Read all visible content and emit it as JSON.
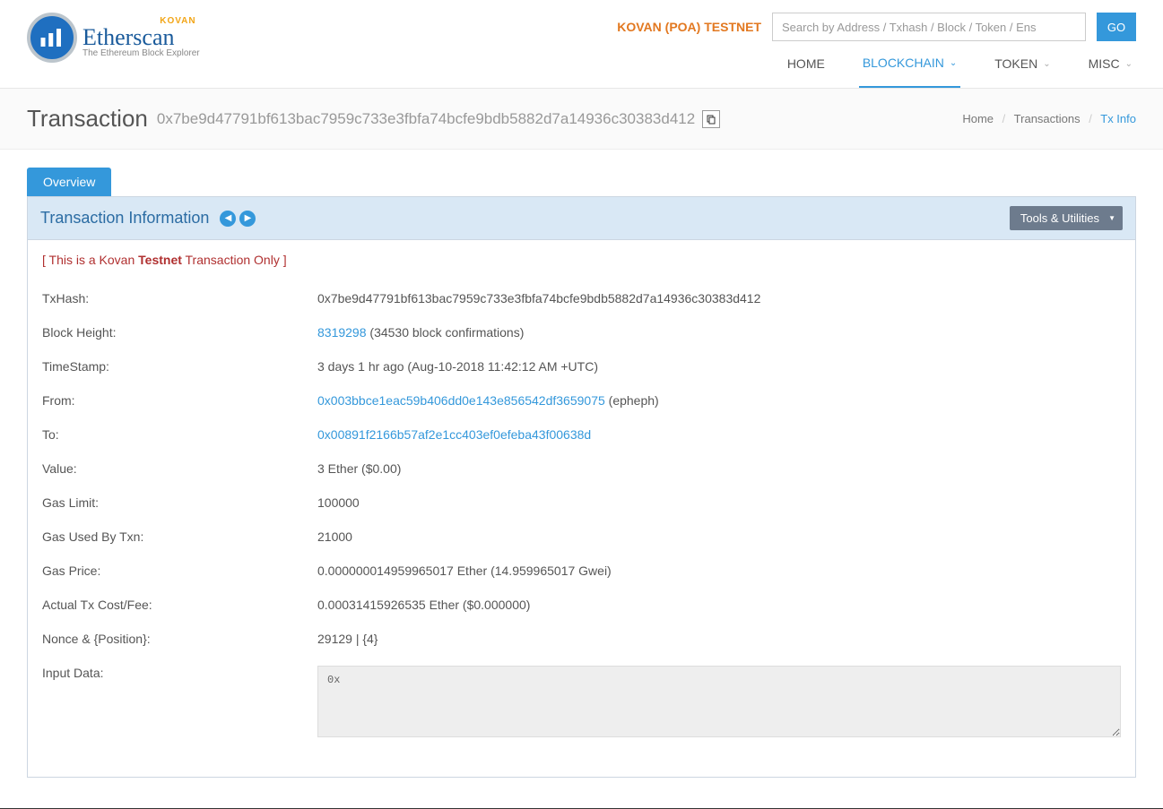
{
  "header": {
    "kovan_tag": "KOVAN",
    "brand": "Etherscan",
    "subtitle": "The Ethereum Block Explorer",
    "testnet_label": "KOVAN (POA) TESTNET",
    "search_placeholder": "Search by Address / Txhash / Block / Token / Ens",
    "go_label": "GO",
    "nav": {
      "home": "HOME",
      "blockchain": "BLOCKCHAIN",
      "token": "TOKEN",
      "misc": "MISC"
    }
  },
  "title": {
    "heading": "Transaction",
    "hash": "0x7be9d47791bf613bac7959c733e3fbfa74bcfe9bdb5882d7a14936c30383d412"
  },
  "breadcrumb": {
    "home": "Home",
    "transactions": "Transactions",
    "current": "Tx Info"
  },
  "tab_overview": "Overview",
  "panel": {
    "title": "Transaction Information",
    "tools_label": "Tools & Utilities",
    "warn_prefix": "[ This is a Kovan ",
    "warn_bold": "Testnet",
    "warn_suffix": " Transaction Only ]"
  },
  "labels": {
    "txhash": "TxHash:",
    "block": "Block Height:",
    "timestamp": "TimeStamp:",
    "from": "From:",
    "to": "To:",
    "value": "Value:",
    "gaslimit": "Gas Limit:",
    "gasused": "Gas Used By Txn:",
    "gasprice": "Gas Price:",
    "cost": "Actual Tx Cost/Fee:",
    "nonce": "Nonce & {Position}:",
    "inputdata": "Input Data:"
  },
  "values": {
    "txhash": "0x7be9d47791bf613bac7959c733e3fbfa74bcfe9bdb5882d7a14936c30383d412",
    "block_link": "8319298",
    "block_conf": " (34530 block confirmations)",
    "timestamp": "3 days 1 hr ago (Aug-10-2018 11:42:12 AM +UTC)",
    "from_link": "0x003bbce1eac59b406dd0e143e856542df3659075",
    "from_suffix": " (epheph)",
    "to_link": "0x00891f2166b57af2e1cc403ef0efeba43f00638d",
    "value": "3 Ether ($0.00)",
    "gaslimit": "100000",
    "gasused": "21000",
    "gasprice": "0.000000014959965017 Ether (14.959965017 Gwei)",
    "cost": "0.00031415926535 Ether ($0.000000)",
    "nonce": "29129 | {4}",
    "inputdata": "0x"
  }
}
